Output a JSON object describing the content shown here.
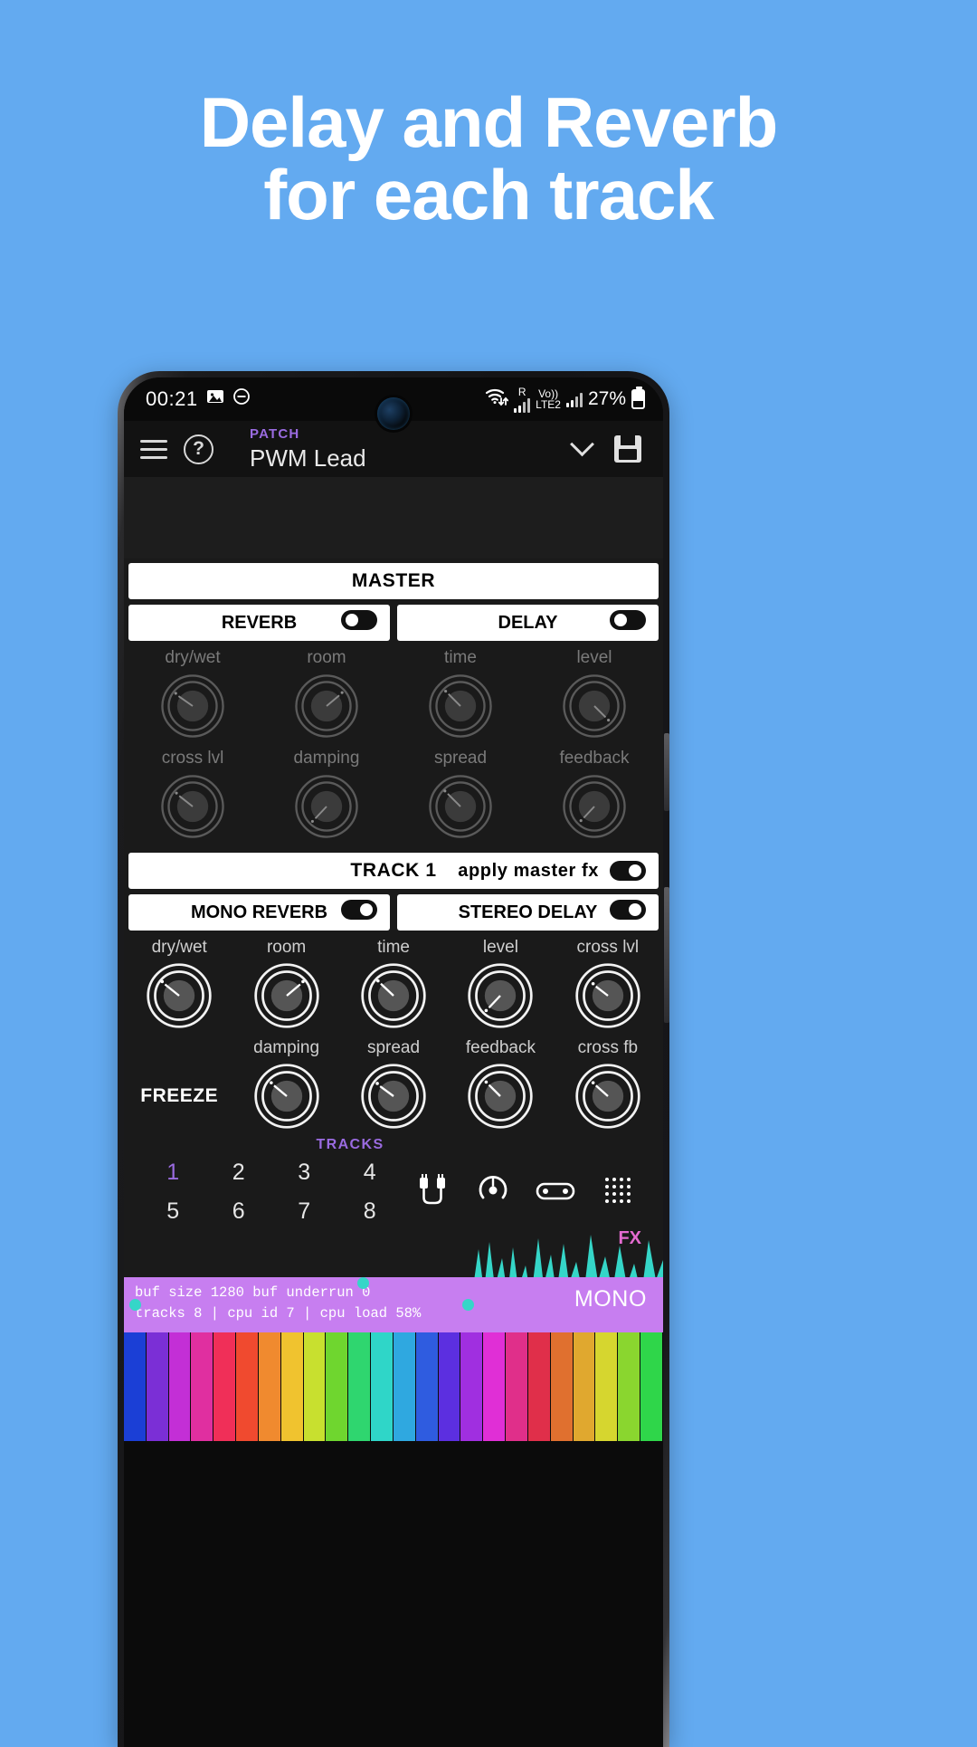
{
  "promo": {
    "line1": "Delay and Reverb",
    "line2": "for each track",
    "bg_color": "#63aaf0",
    "text_color": "#ffffff"
  },
  "status_bar": {
    "time": "00:21",
    "icons_left": [
      "image-icon",
      "do-not-disturb-icon"
    ],
    "wifi": "wifi-icon",
    "roaming_badge": "R",
    "volte_badge": "Vo))",
    "network_label": "LTE2",
    "battery_percent": "27%",
    "battery_icon": "battery-icon"
  },
  "app_bar": {
    "menu_icon": "hamburger-icon",
    "help_icon": "help-circle-icon",
    "patch_kicker": "PATCH",
    "patch_name": "PWM Lead",
    "expand_icon": "chevron-down-icon",
    "save_icon": "save-icon",
    "accent_color": "#9a6be0"
  },
  "master": {
    "title": "MASTER",
    "reverb": {
      "title": "REVERB",
      "enabled": false,
      "knobs_row1": [
        "dry/wet",
        "room"
      ],
      "knobs_row2": [
        "cross lvl",
        "damping"
      ]
    },
    "delay": {
      "title": "DELAY",
      "enabled": false,
      "knobs_row1": [
        "time",
        "level"
      ],
      "knobs_row2": [
        "spread",
        "feedback"
      ]
    }
  },
  "track": {
    "title": "TRACK 1",
    "apply_master_fx_label": "apply master fx",
    "apply_master_fx_enabled": true,
    "reverb": {
      "title": "MONO REVERB",
      "enabled": true
    },
    "delay": {
      "title": "STEREO DELAY",
      "enabled": true
    },
    "row1_labels": [
      "dry/wet",
      "room",
      "time",
      "level",
      "cross lvl"
    ],
    "row2_labels": [
      "FREEZE",
      "damping",
      "spread",
      "feedback",
      "cross fb"
    ],
    "freeze_label": "FREEZE"
  },
  "tracks_nav": {
    "kicker": "TRACKS",
    "numbers": [
      "1",
      "2",
      "3",
      "4",
      "5",
      "6",
      "7",
      "8"
    ],
    "active": "1",
    "icons": [
      "patch-cable-icon",
      "knob-icon",
      "tape-reel-icon",
      "grid-icon"
    ],
    "active_color": "#9a6be0"
  },
  "footer": {
    "status_line1": "buf size 1280  buf underrun 0",
    "status_line2": "tracks 8 | cpu id 7 | cpu load 58%",
    "mono_label": "MONO",
    "fx_label": "FX",
    "overlay_color": "#c77ef0",
    "wave_color": "#35d6c8"
  },
  "keyboard": {
    "key_colors": [
      "#1b3fd6",
      "#7b2fd6",
      "#c32fd6",
      "#e02fa0",
      "#f02f58",
      "#f04a2f",
      "#f08a2f",
      "#f0c32f",
      "#c8e02f",
      "#6fd62f",
      "#2fd66f",
      "#2fd6c8",
      "#2fa8e0",
      "#2f5ce0",
      "#5c2fe0",
      "#a02fe0",
      "#e02fd6",
      "#e02f8a",
      "#e02f4a",
      "#e0702f",
      "#e0a82f",
      "#d6d62f",
      "#8ad62f",
      "#2fd64a"
    ]
  }
}
